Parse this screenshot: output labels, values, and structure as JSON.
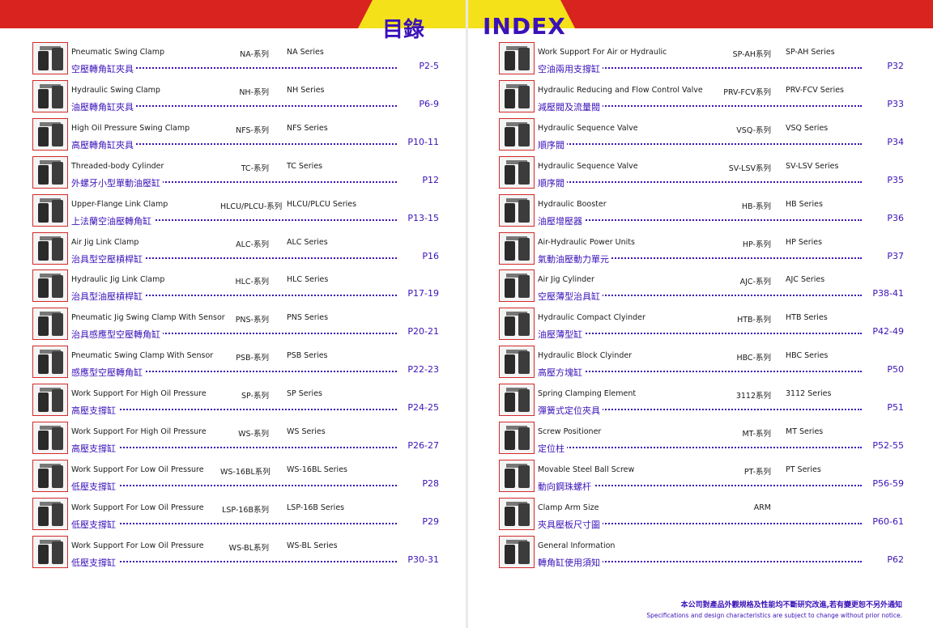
{
  "header": {
    "title_cn": "目錄",
    "title_en": "INDEX",
    "colors": {
      "bar": "#d8231e",
      "tab": "#f5e11a",
      "title": "#3a12b8"
    }
  },
  "left": [
    {
      "en": "Pneumatic Swing Clamp",
      "model": "NA-系列",
      "series": "NA  Series",
      "cn": "空壓轉角缸夾具",
      "page": "P2-5"
    },
    {
      "en": "Hydraulic Swing Clamp",
      "model": "NH-系列",
      "series": "NH  Series",
      "cn": "油壓轉角缸夾具",
      "page": "P6-9"
    },
    {
      "en": "High Oil Pressure Swing Clamp",
      "model": "NFS-系列",
      "series": "NFS  Series",
      "cn": "高壓轉角缸夾具",
      "page": "P10-11"
    },
    {
      "en": "Threaded-body Cylinder",
      "model": "TC-系列",
      "series": "TC  Series",
      "cn": "外螺牙小型單動油壓缸",
      "page": "P12"
    },
    {
      "en": "Upper-Flange Link Clamp",
      "model": "HLCU/PLCU-系列",
      "series": "HLCU/PLCU  Series",
      "cn": "上法蘭空油壓轉角缸",
      "page": "P13-15"
    },
    {
      "en": "Air Jig Link Clamp",
      "model": "ALC-系列",
      "series": "ALC  Series",
      "cn": "治具型空壓槓桿缸",
      "page": "P16"
    },
    {
      "en": "Hydraulic Jig Link Clamp",
      "model": "HLC-系列",
      "series": "HLC  Series",
      "cn": "治具型油壓槓桿缸",
      "page": "P17-19"
    },
    {
      "en": "Pneumatic Jig Swing Clamp With Sensor",
      "model": "PNS-系列",
      "series": "PNS  Series",
      "cn": "治具感應型空壓轉角缸",
      "page": "P20-21"
    },
    {
      "en": "Pneumatic  Swing Clamp With Sensor",
      "model": "PSB-系列",
      "series": "PSB  Series",
      "cn": "感應型空壓轉角缸",
      "page": "P22-23"
    },
    {
      "en": "Work Support For High Oil Pressure",
      "model": "SP-系列",
      "series": "SP  Series",
      "cn": "高壓支撐缸",
      "page": "P24-25"
    },
    {
      "en": "Work Support For High Oil Pressure",
      "model": "WS-系列",
      "series": "WS  Series",
      "cn": "高壓支撐缸",
      "page": "P26-27"
    },
    {
      "en": "Work Support For Low Oil Pressure",
      "model": "WS-16BL系列",
      "series": "WS-16BL  Series",
      "cn": "低壓支撐缸",
      "page": "P28"
    },
    {
      "en": "Work Support For Low Oil Pressure",
      "model": "LSP-16B系列",
      "series": "LSP-16B  Series",
      "cn": "低壓支撐缸",
      "page": "P29"
    },
    {
      "en": "Work Support For Low Oil Pressure",
      "model": "WS-BL系列",
      "series": "WS-BL  Series",
      "cn": "低壓支撐缸",
      "page": "P30-31"
    }
  ],
  "right": [
    {
      "en": "Work Support For Air or Hydraulic",
      "model": "SP-AH系列",
      "series": "SP-AH  Series",
      "cn": "空油兩用支撐缸",
      "page": "P32"
    },
    {
      "en": "Hydraulic Reducing and Flow Control Valve",
      "model": "PRV-FCV系列",
      "series": "PRV-FCV  Series",
      "cn": "減壓閥及流量閥",
      "page": "P33"
    },
    {
      "en": "Hydraulic Sequence Valve",
      "model": "VSQ-系列",
      "series": "VSQ  Series",
      "cn": "順序閥",
      "page": "P34"
    },
    {
      "en": "Hydraulic Sequence Valve",
      "model": "SV-LSV系列",
      "series": "SV-LSV  Series",
      "cn": "順序閥",
      "page": "P35"
    },
    {
      "en": "Hydraulic Booster",
      "model": "HB-系列",
      "series": "HB  Series",
      "cn": "油壓增壓器",
      "page": "P36"
    },
    {
      "en": "Air-Hydraulic Power Units",
      "model": "HP-系列",
      "series": "HP  Series",
      "cn": "氣動油壓動力單元",
      "page": "P37"
    },
    {
      "en": "Air Jig Cylinder",
      "model": "AJC-系列",
      "series": "AJC  Series",
      "cn": "空壓薄型治具缸",
      "page": "P38-41"
    },
    {
      "en": "Hydraulic Compact Clyinder",
      "model": "HTB-系列",
      "series": "HTB  Series",
      "cn": "油壓薄型缸",
      "page": "P42-49"
    },
    {
      "en": "Hydraulic Block Clyinder",
      "model": "HBC-系列",
      "series": "HBC  Series",
      "cn": "高壓方塊缸",
      "page": "P50"
    },
    {
      "en": "Spring Clamping Element",
      "model": "3112系列",
      "series": "3112  Series",
      "cn": "彈簧式定位夾具",
      "page": "P51"
    },
    {
      "en": "Screw Positioner",
      "model": "MT-系列",
      "series": "MT  Series",
      "cn": "定位柱",
      "page": "P52-55"
    },
    {
      "en": "Movable Steel Ball Screw",
      "model": "PT-系列",
      "series": "PT  Series",
      "cn": "動向鋼珠螺杆",
      "page": "P56-59"
    },
    {
      "en": "Clamp Arm Size",
      "model": "ARM",
      "series": "",
      "cn": "夾具壓板尺寸圖",
      "page": "P60-61"
    },
    {
      "en": "General Information",
      "model": "",
      "series": "",
      "cn": "轉角缸使用須知",
      "page": "P62"
    }
  ],
  "footnote": {
    "cn": "本公司對產品外觀規格及性能均不斷研究改進,若有變更恕不另外通知",
    "en": "Specifications and design characteristics are subject to change without prior notice."
  }
}
